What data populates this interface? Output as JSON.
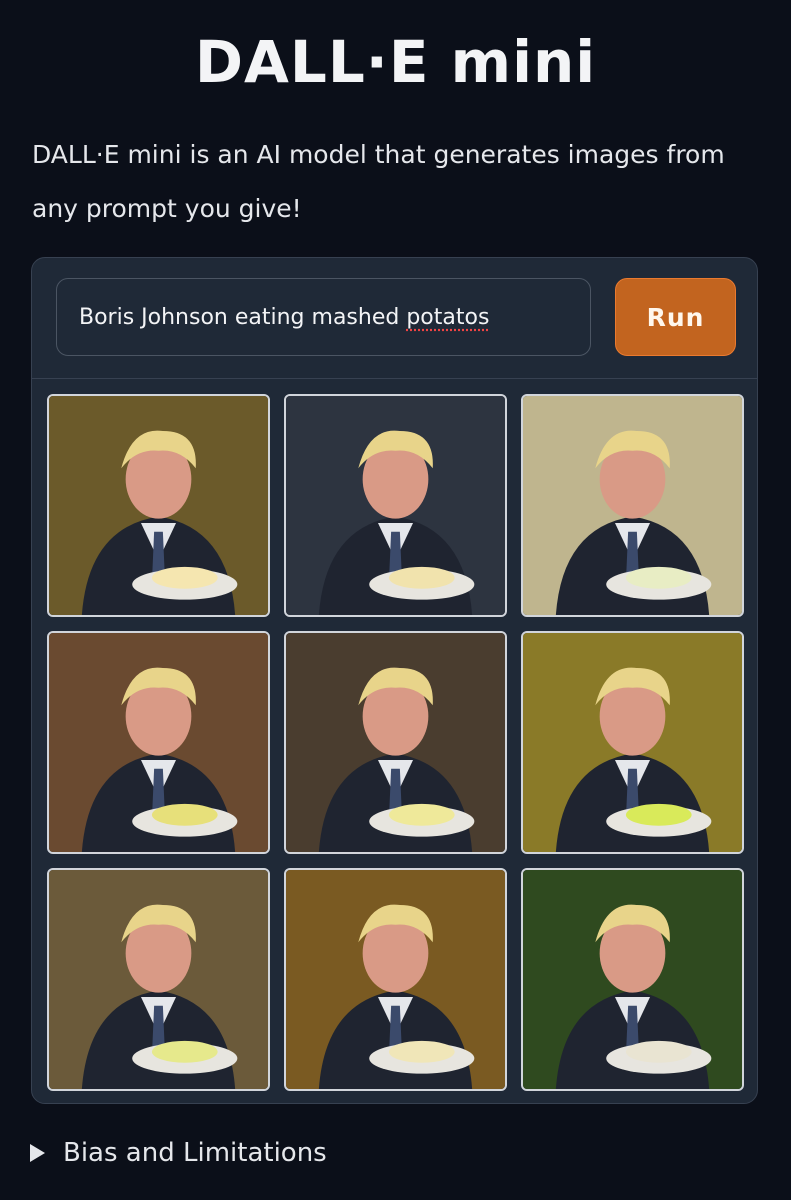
{
  "app": {
    "title": "DALL·E mini",
    "description": "DALL·E mini is an AI model that generates images from any prompt you give!"
  },
  "prompt_box": {
    "value_before": "Boris Johnson eating mashed ",
    "value_misspelled": "potatos"
  },
  "run_button": {
    "label": "Run"
  },
  "gallery": {
    "images": [
      {
        "icon": "generated-image",
        "bg": "#6b5a2a",
        "accent": "#f5e6b0"
      },
      {
        "icon": "generated-image",
        "bg": "#2d3440",
        "accent": "#f1e3ad"
      },
      {
        "icon": "generated-image",
        "bg": "#bfb58e",
        "accent": "#e8edc4"
      },
      {
        "icon": "generated-image",
        "bg": "#6a4a30",
        "accent": "#e7e07a"
      },
      {
        "icon": "generated-image",
        "bg": "#4a3d2f",
        "accent": "#efe99a"
      },
      {
        "icon": "generated-image",
        "bg": "#8a7a28",
        "accent": "#d9ea5a"
      },
      {
        "icon": "generated-image",
        "bg": "#6b5a3a",
        "accent": "#e6e98c"
      },
      {
        "icon": "generated-image",
        "bg": "#7a5a22",
        "accent": "#f0e6b8"
      },
      {
        "icon": "generated-image",
        "bg": "#2f4a1f",
        "accent": "#e9e4d2"
      }
    ]
  },
  "bias_section": {
    "label": "Bias and Limitations",
    "icon": "disclosure-triangle-icon"
  }
}
